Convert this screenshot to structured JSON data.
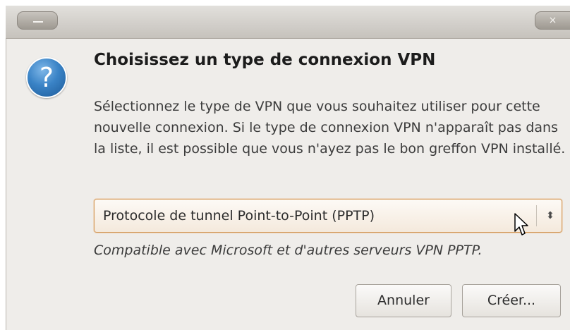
{
  "window": {
    "close_glyph": "×"
  },
  "dialog": {
    "icon_glyph": "?",
    "title": "Choisissez un type de connexion VPN",
    "description": "Sélectionnez le type de VPN que vous souhaitez utiliser pour cette nouvelle connexion. Si le type de connexion VPN n'apparaît pas dans la liste, il est possible que vous n'ayez pas le bon greffon VPN installé.",
    "vpn_type_selected": "Protocole de tunnel Point-to-Point (PPTP)",
    "combo_arrow_glyph": "⬍",
    "hint": "Compatible avec Microsoft et d'autres serveurs VPN PPTP.",
    "cancel_label": "Annuler",
    "create_label": "Créer..."
  },
  "colors": {
    "dialog_bg": "#efedea",
    "focus_border": "#d49b5c",
    "icon_blue": "#3a83c6"
  }
}
